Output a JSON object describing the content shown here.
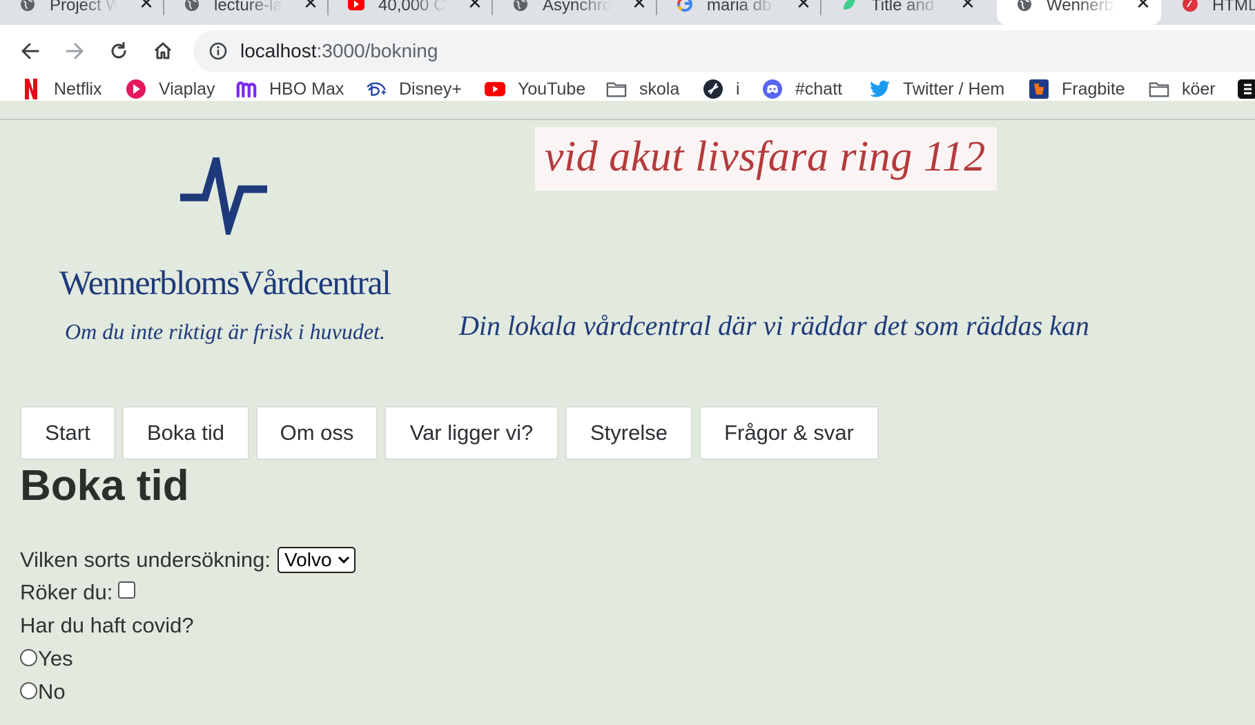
{
  "browser": {
    "tabs": [
      {
        "title": "Project W",
        "favicon": "globe-icon"
      },
      {
        "title": "lecture-la",
        "favicon": "globe-icon"
      },
      {
        "title": "40,000 C",
        "favicon": "youtube-icon"
      },
      {
        "title": "Asynchro",
        "favicon": "globe-icon"
      },
      {
        "title": "maria db c",
        "favicon": "google-icon"
      },
      {
        "title": "Title and s",
        "favicon": "leaf-icon"
      },
      {
        "title": "Wennerbl",
        "favicon": "globe-icon",
        "active": true
      },
      {
        "title": "HTML",
        "favicon": "red-circle-icon"
      }
    ],
    "close_glyph": "✕",
    "address": {
      "host": "localhost",
      "path": ":3000/bokning"
    },
    "bookmarks": [
      {
        "label": "Netflix",
        "icon": "netflix-icon"
      },
      {
        "label": "Viaplay",
        "icon": "viaplay-icon"
      },
      {
        "label": "HBO Max",
        "icon": "hbo-max-icon"
      },
      {
        "label": "Disney+",
        "icon": "disney-plus-icon"
      },
      {
        "label": "YouTube",
        "icon": "youtube-icon"
      },
      {
        "label": "skola",
        "icon": "folder-icon"
      },
      {
        "label": "i",
        "icon": "compass-icon"
      },
      {
        "label": "#chatt",
        "icon": "discord-icon"
      },
      {
        "label": "Twitter / Hem",
        "icon": "twitter-icon"
      },
      {
        "label": "Fragbite",
        "icon": "fragbite-icon"
      },
      {
        "label": "köer",
        "icon": "folder-icon"
      }
    ]
  },
  "header": {
    "logo_name": "WennerblomsVårdcentral",
    "logo_tagline": "Om du inte riktigt är frisk i huvudet.",
    "emergency": "vid akut livsfara ring 112",
    "slogan": "Din lokala vårdcentral där vi räddar det som räddas kan",
    "brand_color": "#1f3a7a",
    "emergency_color": "#b43a3d"
  },
  "menu": [
    "Start",
    "Boka tid",
    "Om oss",
    "Var ligger vi?",
    "Styrelse",
    "Frågor & svar"
  ],
  "main": {
    "heading": "Boka tid",
    "exam_label": "Vilken sorts undersökning:",
    "exam_selected": "Volvo",
    "smoke_label": "Röker du:",
    "covid_label": "Har du haft covid?",
    "options": [
      "Yes",
      "No"
    ]
  },
  "colors": {
    "page_bg": "#e2eadf"
  }
}
